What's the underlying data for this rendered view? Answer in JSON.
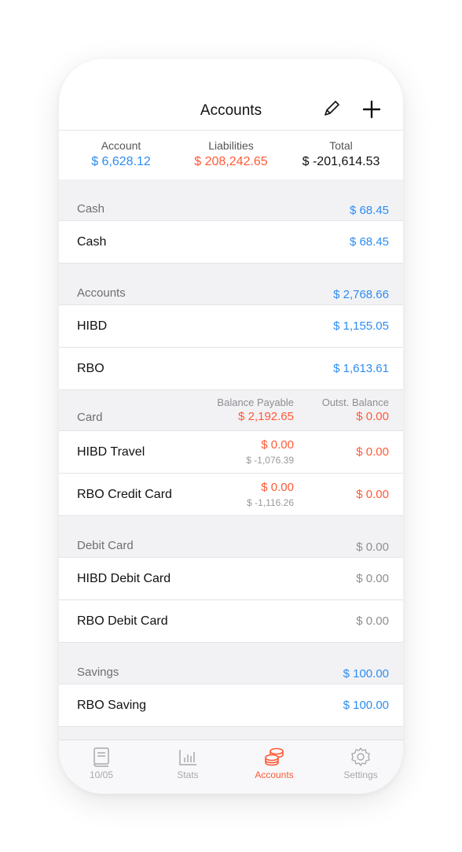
{
  "nav": {
    "title": "Accounts"
  },
  "summary": {
    "account_label": "Account",
    "account_value": "$ 6,628.12",
    "liabilities_label": "Liabilities",
    "liabilities_value": "$ 208,242.65",
    "total_label": "Total",
    "total_value": "$ -201,614.53"
  },
  "cash": {
    "header": "Cash",
    "header_amount": "$ 68.45",
    "items": [
      {
        "name": "Cash",
        "amount": "$ 68.45"
      }
    ]
  },
  "accounts": {
    "header": "Accounts",
    "header_amount": "$ 2,768.66",
    "items": [
      {
        "name": "HIBD",
        "amount": "$ 1,155.05"
      },
      {
        "name": "RBO",
        "amount": "$ 1,613.61"
      }
    ]
  },
  "card": {
    "header": "Card",
    "balance_payable_label": "Balance Payable",
    "balance_payable_value": "$ 2,192.65",
    "outstanding_label": "Outst. Balance",
    "outstanding_value": "$ 0.00",
    "items": [
      {
        "name": "HIBD Travel",
        "payable": "$ 0.00",
        "sub": "$ -1,076.39",
        "outstanding": "$ 0.00"
      },
      {
        "name": "RBO Credit Card",
        "payable": "$ 0.00",
        "sub": "$ -1,116.26",
        "outstanding": "$ 0.00"
      }
    ]
  },
  "debit": {
    "header": "Debit Card",
    "header_amount": "$ 0.00",
    "items": [
      {
        "name": "HIBD Debit Card",
        "amount": "$ 0.00"
      },
      {
        "name": "RBO Debit Card",
        "amount": "$ 0.00"
      }
    ]
  },
  "savings": {
    "header": "Savings",
    "header_amount": "$ 100.00",
    "items": [
      {
        "name": "RBO Saving",
        "amount": "$ 100.00"
      }
    ]
  },
  "tabs": [
    {
      "label": "10/05",
      "icon": "book-icon"
    },
    {
      "label": "Stats",
      "icon": "bar-chart-icon"
    },
    {
      "label": "Accounts",
      "icon": "coins-icon",
      "active": true
    },
    {
      "label": "Settings",
      "icon": "gear-icon"
    }
  ],
  "colors": {
    "blue": "#2e8df0",
    "orange": "#ff5a36",
    "gray": "#8e8e93"
  }
}
